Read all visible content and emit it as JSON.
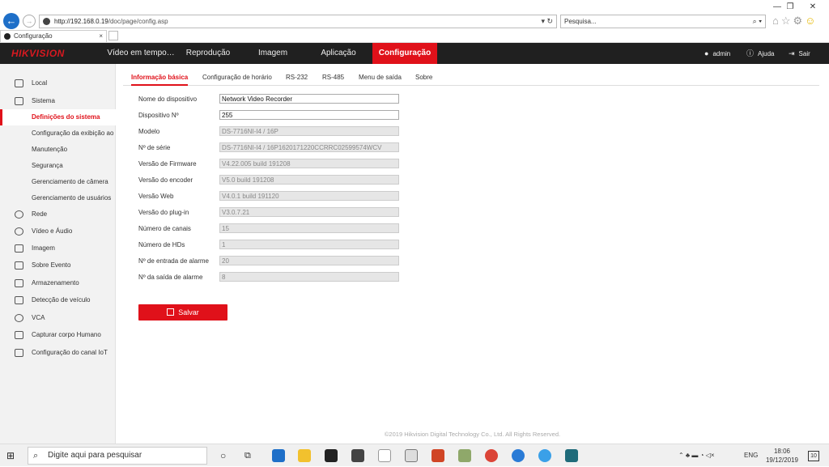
{
  "browser": {
    "url_host": "http://192.168.0.19",
    "url_path": "/doc/page/config.asp",
    "search_placeholder": "Pesquisa...",
    "tab_title": "Configuração",
    "win_controls": [
      "—",
      "❐",
      "✕"
    ]
  },
  "topnav": {
    "logo": "HIKVISION",
    "items": [
      "Vídeo em tempo…",
      "Reprodução",
      "Imagem",
      "Aplicação",
      "Configuração"
    ],
    "user": "admin",
    "help": "Ajuda",
    "exit": "Sair"
  },
  "sidebar": {
    "items": [
      {
        "label": "Local"
      },
      {
        "label": "Sistema"
      },
      {
        "label": "Definições do sistema"
      },
      {
        "label": "Configuração da exibição ao"
      },
      {
        "label": "Manutenção"
      },
      {
        "label": "Segurança"
      },
      {
        "label": "Gerenciamento de câmera"
      },
      {
        "label": "Gerenciamento de usuários"
      },
      {
        "label": "Rede"
      },
      {
        "label": "Vídeo e Áudio"
      },
      {
        "label": "Imagem"
      },
      {
        "label": "Sobre Evento"
      },
      {
        "label": "Armazenamento"
      },
      {
        "label": "Detecção de veículo"
      },
      {
        "label": "VCA"
      },
      {
        "label": "Capturar corpo Humano"
      },
      {
        "label": "Configuração do canal IoT"
      }
    ]
  },
  "subtabs": [
    "Informação básica",
    "Configuração de horário",
    "RS-232",
    "RS-485",
    "Menu de saída",
    "Sobre"
  ],
  "form": {
    "fields": [
      {
        "label": "Nome do dispositivo",
        "value": "Network Video Recorder"
      },
      {
        "label": "Dispositivo Nº",
        "value": "255"
      },
      {
        "label": "Modelo",
        "value": "DS-7716NI-I4 / 16P"
      },
      {
        "label": "Nº de série",
        "value": "DS-7716NI-I4 / 16P1620171220CCRRC02599574WCV"
      },
      {
        "label": "Versão de Firmware",
        "value": "V4.22.005 build 191208"
      },
      {
        "label": "Versão do encoder",
        "value": "V5.0 build 191208"
      },
      {
        "label": "Versão Web",
        "value": "V4.0.1 build 191120"
      },
      {
        "label": "Versão do plug-in",
        "value": "V3.0.7.21"
      },
      {
        "label": "Número de canais",
        "value": "15"
      },
      {
        "label": "Número de HDs",
        "value": "1"
      },
      {
        "label": "Nº de entrada de alarme",
        "value": "20"
      },
      {
        "label": "Nº da saída de alarme",
        "value": "8"
      }
    ],
    "save_label": "Salvar"
  },
  "footer": "©2019 Hikvision Digital Technology Co., Ltd. All Rights Reserved.",
  "taskbar": {
    "search_placeholder": "Digite aqui para pesquisar",
    "lang": "ENG",
    "time": "18:06",
    "date": "19/12/2019",
    "notif_count": "10"
  }
}
